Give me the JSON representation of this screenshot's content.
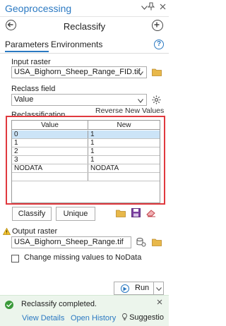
{
  "window": {
    "title": "Geoprocessing"
  },
  "tool": {
    "name": "Reclassify"
  },
  "tabs": [
    {
      "label": "Parameters",
      "active": true
    },
    {
      "label": "Environments",
      "active": false
    }
  ],
  "params": {
    "input_raster_label": "Input raster",
    "input_raster_value": "USA_Bighorn_Sheep_Range_FID.tif",
    "reclass_field_label": "Reclass field",
    "reclass_field_value": "Value",
    "reclassification_label": "Reclassification",
    "reverse_new_values": "Reverse New Values",
    "output_raster_label": "Output raster",
    "output_raster_value": "USA_Bighorn_Sheep_Range.tif",
    "change_missing_label": "Change missing values to NoData",
    "change_missing_checked": false
  },
  "table": {
    "headers": [
      "Value",
      "New"
    ],
    "rows": [
      {
        "value": "0",
        "new": "1"
      },
      {
        "value": "1",
        "new": "1"
      },
      {
        "value": "2",
        "new": "1"
      },
      {
        "value": "3",
        "new": "1"
      },
      {
        "value": "NODATA",
        "new": "NODATA"
      },
      {
        "value": "",
        "new": ""
      }
    ]
  },
  "buttons": {
    "classify": "Classify",
    "unique": "Unique",
    "run": "Run"
  },
  "status": {
    "message": "Reclassify completed.",
    "view_details": "View Details",
    "open_history": "Open History",
    "suggestions": "Suggestio"
  },
  "colors": {
    "accent": "#2b79c2",
    "highlight": "#e0393e",
    "success": "#3a9a3a",
    "row_selected": "#cce4f7"
  }
}
